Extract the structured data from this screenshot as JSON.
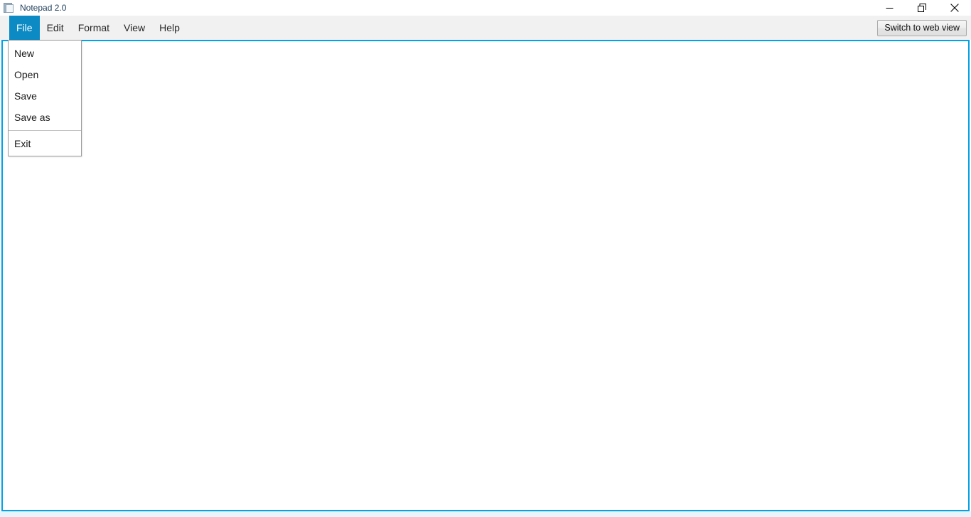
{
  "window": {
    "title": "Notepad 2.0",
    "icon": "notepad-icon",
    "controls": {
      "minimize": "minimize-icon",
      "maximize": "restore-icon",
      "close": "close-icon"
    }
  },
  "menubar": {
    "items": [
      {
        "label": "File",
        "active": true
      },
      {
        "label": "Edit",
        "active": false
      },
      {
        "label": "Format",
        "active": false
      },
      {
        "label": "View",
        "active": false
      },
      {
        "label": "Help",
        "active": false
      }
    ],
    "switch_view_label": "Switch to web view"
  },
  "file_menu": {
    "open": true,
    "items": [
      {
        "label": "New",
        "separator_after": false
      },
      {
        "label": "Open",
        "separator_after": false
      },
      {
        "label": "Save",
        "separator_after": false
      },
      {
        "label": "Save as",
        "separator_after": true
      },
      {
        "label": "Exit",
        "separator_after": false
      }
    ]
  },
  "editor": {
    "value": "",
    "placeholder": ""
  },
  "colors": {
    "accent": "#0b8ac4",
    "content_border": "#00a2e8",
    "menubar_bg": "#f1f1f1",
    "title_text": "#1c3c5a",
    "bottom_strip": "#e8f4fb"
  }
}
